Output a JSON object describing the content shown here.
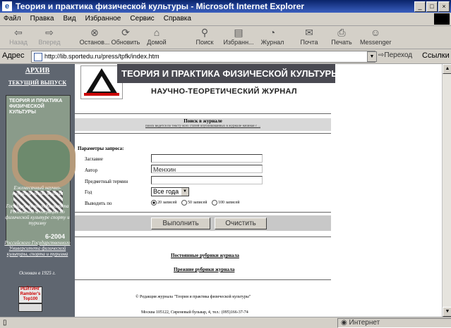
{
  "window": {
    "title": "Теория и практика физической культуры - Microsoft Internet Explorer",
    "controls": [
      "_",
      "□",
      "×"
    ]
  },
  "menu": [
    "Файл",
    "Правка",
    "Вид",
    "Избранное",
    "Сервис",
    "Справка"
  ],
  "toolbar": {
    "back": "Назад",
    "forward": "Вперед",
    "stop": "Останов...",
    "refresh": "Обновить",
    "home": "Домой",
    "search": "Поиск",
    "favorites": "Избранн...",
    "history": "Журнал",
    "mail": "Почта",
    "print": "Печать",
    "messenger": "Messenger"
  },
  "address": {
    "label": "Адрес",
    "url": "http://lib.sportedu.ru/press/tpfk/index.htm",
    "go": "Переход",
    "links": "Ссылки"
  },
  "sidebar": {
    "archive": "АРХИВ",
    "current_issue": "ТЕКУЩИЙ ВЫПУСК",
    "cover_title": "ТЕОРИЯ И ПРАКТИКА ФИЗИЧЕСКОЙ КУЛЬТУРЫ",
    "cover_number": "6-2004",
    "desc": "Ежемесячный научно-теоретический журнал",
    "founder1": "Государственного Комитета Российской Федерации по физической культуре спорту и туризму",
    "founder2": "Российского Государственного Университета физической культуры, спорта и туризма",
    "founded": "Основан в 1925 г.",
    "badge": "РЕЙТИНГ Rambler's Top100"
  },
  "header": {
    "title": "ТЕОРИЯ И ПРАКТИКА ФИЗИЧЕСКОЙ КУЛЬТУРЫ",
    "subtitle": "НАУЧНО-ТЕОРЕТИЧЕСКИЙ ЖУРНАЛ"
  },
  "search": {
    "title": "Поиск в журнале",
    "subtitle": "поиск ведется по тексту всех статей опубликованных в журнале начиная с ..."
  },
  "form": {
    "params_title": "Параметры запроса:",
    "fields": [
      {
        "label": "Заглавие",
        "value": ""
      },
      {
        "label": "Автор",
        "value": "Менхин"
      },
      {
        "label": "Предметный термин",
        "value": ""
      }
    ],
    "year_label": "Год",
    "year_value": "Все года",
    "results_label": "Выводить по",
    "results_options": [
      "20 записей",
      "50 записей",
      "100 записей"
    ],
    "results_selected": "20 записей"
  },
  "buttons": {
    "execute": "Выполнить",
    "clear": "Очистить"
  },
  "links": {
    "permanent": "Постоянные рубрики журнала",
    "former": "Прежние рубрики журнала"
  },
  "footer": {
    "copyright": "© Редакция журнала \"Теория и практика физической культуры\"",
    "address": "Москва 105122, Сиреневый бульвар, 4, тел.: (095)166-37-74"
  },
  "status": {
    "zone": "Интернет"
  }
}
